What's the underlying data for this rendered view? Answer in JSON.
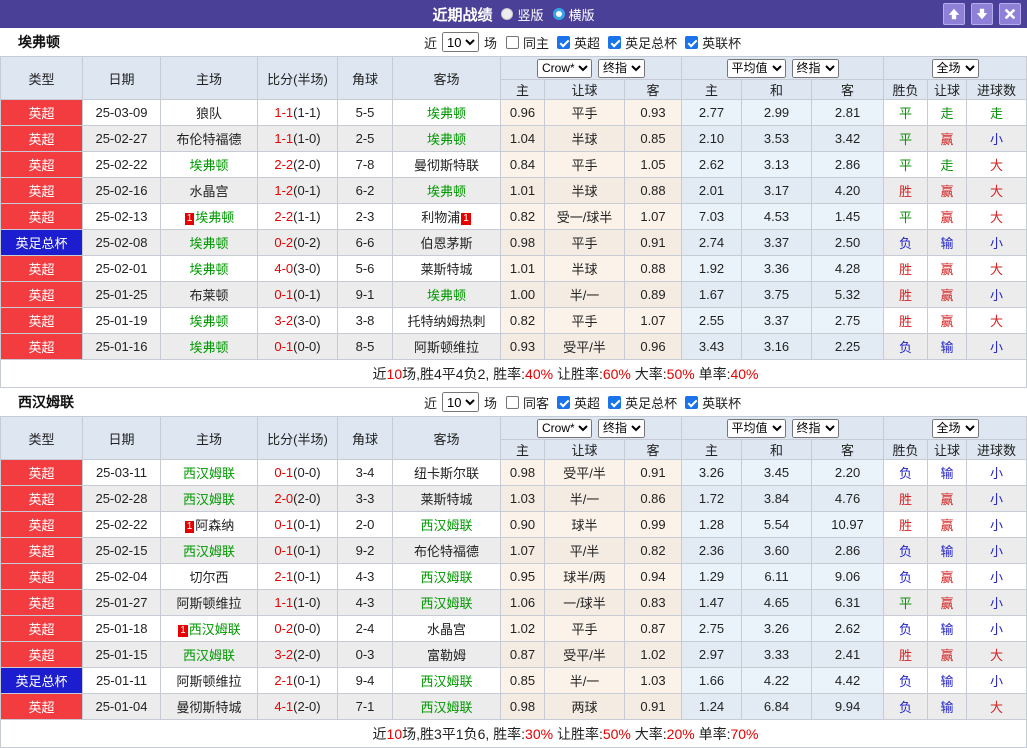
{
  "titlebar": {
    "title": "近期战绩",
    "radios": [
      {
        "label": "竖版",
        "selected": true
      },
      {
        "label": "横版",
        "selected": false
      }
    ],
    "buttons": {
      "up": "move-up",
      "down": "move-down",
      "close": "close"
    }
  },
  "colors": {
    "titlebar_bg": "#4b4098",
    "titlebar_button_bg": "#8d80d6",
    "header_bg": "#dde6f1",
    "league_colors": {
      "英超": "#f23c40",
      "英足总杯": "#1d1dd0"
    },
    "team_highlight": "#009900",
    "score_red": "#e60000",
    "handicap_col_bg": "#fbf3ea",
    "euro_col_bg": "#eaf3fa",
    "row_alt_bg": "#ececec",
    "summary_red": "#e60000",
    "result_map": {
      "胜": "#d42424",
      "赢": "#d42424",
      "大": "#d42424",
      "平": "#089008",
      "走": "#089008",
      "负": "#2424c8",
      "输": "#2424c8",
      "小": "#2424c8"
    }
  },
  "columns": {
    "type": "类型",
    "date": "日期",
    "home": "主场",
    "score": "比分(半场)",
    "corner": "角球",
    "away": "客场",
    "h": "主",
    "handicap": "让球",
    "a": "客",
    "eu_h": "主",
    "eu_d": "和",
    "eu_a": "客",
    "wdl": "胜负",
    "ah_res": "让球",
    "goals": "进球数"
  },
  "sections": [
    {
      "team": "埃弗顿",
      "controls": {
        "near": "近",
        "count": "10",
        "unit": "场",
        "same_label": "同主",
        "same_checked": false,
        "filters": [
          {
            "label": "英超",
            "checked": true
          },
          {
            "label": "英足总杯",
            "checked": true
          },
          {
            "label": "英联杯",
            "checked": true
          }
        ]
      },
      "dropdowns": {
        "odds_source": "Crow*",
        "odds_final": "终指",
        "euro_type": "平均值",
        "euro_final": "终指",
        "scope": "全场"
      },
      "rows": [
        {
          "league": "英超",
          "date": "25-03-09",
          "home": {
            "t": "狼队"
          },
          "score": "1-1",
          "half": "(1-1)",
          "corners": "5-5",
          "away": {
            "t": "埃弗顿",
            "g": true
          },
          "ah": [
            "0.96",
            "平手",
            "0.93"
          ],
          "eu": [
            "2.77",
            "2.99",
            "2.81"
          ],
          "res": [
            "平",
            "走",
            "走"
          ]
        },
        {
          "league": "英超",
          "date": "25-02-27",
          "home": {
            "t": "布伦特福德"
          },
          "score": "1-1",
          "half": "(1-0)",
          "corners": "2-5",
          "away": {
            "t": "埃弗顿",
            "g": true
          },
          "ah": [
            "1.04",
            "半球",
            "0.85"
          ],
          "eu": [
            "2.10",
            "3.53",
            "3.42"
          ],
          "res": [
            "平",
            "赢",
            "小"
          ]
        },
        {
          "league": "英超",
          "date": "25-02-22",
          "home": {
            "t": "埃弗顿",
            "g": true
          },
          "score": "2-2",
          "half": "(2-0)",
          "corners": "7-8",
          "away": {
            "t": "曼彻斯特联"
          },
          "ah": [
            "0.84",
            "平手",
            "1.05"
          ],
          "eu": [
            "2.62",
            "3.13",
            "2.86"
          ],
          "res": [
            "平",
            "走",
            "大"
          ]
        },
        {
          "league": "英超",
          "date": "25-02-16",
          "home": {
            "t": "水晶宫"
          },
          "score": "1-2",
          "half": "(0-1)",
          "corners": "6-2",
          "away": {
            "t": "埃弗顿",
            "g": true
          },
          "ah": [
            "1.01",
            "半球",
            "0.88"
          ],
          "eu": [
            "2.01",
            "3.17",
            "4.20"
          ],
          "res": [
            "胜",
            "赢",
            "大"
          ]
        },
        {
          "league": "英超",
          "date": "25-02-13",
          "home": {
            "t": "埃弗顿",
            "g": true,
            "b": "1",
            "bp": "pre"
          },
          "score": "2-2",
          "half": "(1-1)",
          "corners": "2-3",
          "away": {
            "t": "利物浦",
            "b": "1",
            "bp": "post"
          },
          "ah": [
            "0.82",
            "受一/球半",
            "1.07"
          ],
          "eu": [
            "7.03",
            "4.53",
            "1.45"
          ],
          "res": [
            "平",
            "赢",
            "大"
          ]
        },
        {
          "league": "英足总杯",
          "date": "25-02-08",
          "home": {
            "t": "埃弗顿",
            "g": true
          },
          "score": "0-2",
          "half": "(0-2)",
          "corners": "6-6",
          "away": {
            "t": "伯恩茅斯"
          },
          "ah": [
            "0.98",
            "平手",
            "0.91"
          ],
          "eu": [
            "2.74",
            "3.37",
            "2.50"
          ],
          "res": [
            "负",
            "输",
            "小"
          ]
        },
        {
          "league": "英超",
          "date": "25-02-01",
          "home": {
            "t": "埃弗顿",
            "g": true
          },
          "score": "4-0",
          "half": "(3-0)",
          "corners": "5-6",
          "away": {
            "t": "莱斯特城"
          },
          "ah": [
            "1.01",
            "半球",
            "0.88"
          ],
          "eu": [
            "1.92",
            "3.36",
            "4.28"
          ],
          "res": [
            "胜",
            "赢",
            "大"
          ]
        },
        {
          "league": "英超",
          "date": "25-01-25",
          "home": {
            "t": "布莱顿"
          },
          "score": "0-1",
          "half": "(0-1)",
          "corners": "9-1",
          "away": {
            "t": "埃弗顿",
            "g": true
          },
          "ah": [
            "1.00",
            "半/一",
            "0.89"
          ],
          "eu": [
            "1.67",
            "3.75",
            "5.32"
          ],
          "res": [
            "胜",
            "赢",
            "小"
          ]
        },
        {
          "league": "英超",
          "date": "25-01-19",
          "home": {
            "t": "埃弗顿",
            "g": true
          },
          "score": "3-2",
          "half": "(3-0)",
          "corners": "3-8",
          "away": {
            "t": "托特纳姆热刺"
          },
          "ah": [
            "0.82",
            "平手",
            "1.07"
          ],
          "eu": [
            "2.55",
            "3.37",
            "2.75"
          ],
          "res": [
            "胜",
            "赢",
            "大"
          ]
        },
        {
          "league": "英超",
          "date": "25-01-16",
          "home": {
            "t": "埃弗顿",
            "g": true
          },
          "score": "0-1",
          "half": "(0-0)",
          "corners": "8-5",
          "away": {
            "t": "阿斯顿维拉"
          },
          "ah": [
            "0.93",
            "受平/半",
            "0.96"
          ],
          "eu": [
            "3.43",
            "3.16",
            "2.25"
          ],
          "res": [
            "负",
            "输",
            "小"
          ]
        }
      ],
      "summary": [
        {
          "t": "近",
          "r": false
        },
        {
          "t": "10",
          "r": true
        },
        {
          "t": "场,胜4平4负2, 胜率:",
          "r": false
        },
        {
          "t": "40%",
          "r": true
        },
        {
          "t": " 让胜率:",
          "r": false
        },
        {
          "t": "60%",
          "r": true
        },
        {
          "t": " 大率:",
          "r": false
        },
        {
          "t": "50%",
          "r": true
        },
        {
          "t": " 单率:",
          "r": false
        },
        {
          "t": "40%",
          "r": true
        }
      ]
    },
    {
      "team": "西汉姆联",
      "controls": {
        "near": "近",
        "count": "10",
        "unit": "场",
        "same_label": "同客",
        "same_checked": false,
        "filters": [
          {
            "label": "英超",
            "checked": true
          },
          {
            "label": "英足总杯",
            "checked": true
          },
          {
            "label": "英联杯",
            "checked": true
          }
        ]
      },
      "dropdowns": {
        "odds_source": "Crow*",
        "odds_final": "终指",
        "euro_type": "平均值",
        "euro_final": "终指",
        "scope": "全场"
      },
      "rows": [
        {
          "league": "英超",
          "date": "25-03-11",
          "home": {
            "t": "西汉姆联",
            "g": true
          },
          "score": "0-1",
          "half": "(0-0)",
          "corners": "3-4",
          "away": {
            "t": "纽卡斯尔联"
          },
          "ah": [
            "0.98",
            "受平/半",
            "0.91"
          ],
          "eu": [
            "3.26",
            "3.45",
            "2.20"
          ],
          "res": [
            "负",
            "输",
            "小"
          ]
        },
        {
          "league": "英超",
          "date": "25-02-28",
          "home": {
            "t": "西汉姆联",
            "g": true
          },
          "score": "2-0",
          "half": "(2-0)",
          "corners": "3-3",
          "away": {
            "t": "莱斯特城"
          },
          "ah": [
            "1.03",
            "半/一",
            "0.86"
          ],
          "eu": [
            "1.72",
            "3.84",
            "4.76"
          ],
          "res": [
            "胜",
            "赢",
            "小"
          ]
        },
        {
          "league": "英超",
          "date": "25-02-22",
          "home": {
            "t": "阿森纳",
            "b": "1",
            "bp": "pre"
          },
          "score": "0-1",
          "half": "(0-1)",
          "corners": "2-0",
          "away": {
            "t": "西汉姆联",
            "g": true
          },
          "ah": [
            "0.90",
            "球半",
            "0.99"
          ],
          "eu": [
            "1.28",
            "5.54",
            "10.97"
          ],
          "res": [
            "胜",
            "赢",
            "小"
          ]
        },
        {
          "league": "英超",
          "date": "25-02-15",
          "home": {
            "t": "西汉姆联",
            "g": true
          },
          "score": "0-1",
          "half": "(0-1)",
          "corners": "9-2",
          "away": {
            "t": "布伦特福德"
          },
          "ah": [
            "1.07",
            "平/半",
            "0.82"
          ],
          "eu": [
            "2.36",
            "3.60",
            "2.86"
          ],
          "res": [
            "负",
            "输",
            "小"
          ]
        },
        {
          "league": "英超",
          "date": "25-02-04",
          "home": {
            "t": "切尔西"
          },
          "score": "2-1",
          "half": "(0-1)",
          "corners": "4-3",
          "away": {
            "t": "西汉姆联",
            "g": true
          },
          "ah": [
            "0.95",
            "球半/两",
            "0.94"
          ],
          "eu": [
            "1.29",
            "6.11",
            "9.06"
          ],
          "res": [
            "负",
            "赢",
            "小"
          ]
        },
        {
          "league": "英超",
          "date": "25-01-27",
          "home": {
            "t": "阿斯顿维拉"
          },
          "score": "1-1",
          "half": "(1-0)",
          "corners": "4-3",
          "away": {
            "t": "西汉姆联",
            "g": true
          },
          "ah": [
            "1.06",
            "一/球半",
            "0.83"
          ],
          "eu": [
            "1.47",
            "4.65",
            "6.31"
          ],
          "res": [
            "平",
            "赢",
            "小"
          ]
        },
        {
          "league": "英超",
          "date": "25-01-18",
          "home": {
            "t": "西汉姆联",
            "g": true,
            "b": "1",
            "bp": "pre"
          },
          "score": "0-2",
          "half": "(0-0)",
          "corners": "2-4",
          "away": {
            "t": "水晶宫"
          },
          "ah": [
            "1.02",
            "平手",
            "0.87"
          ],
          "eu": [
            "2.75",
            "3.26",
            "2.62"
          ],
          "res": [
            "负",
            "输",
            "小"
          ]
        },
        {
          "league": "英超",
          "date": "25-01-15",
          "home": {
            "t": "西汉姆联",
            "g": true
          },
          "score": "3-2",
          "half": "(2-0)",
          "corners": "0-3",
          "away": {
            "t": "富勒姆"
          },
          "ah": [
            "0.87",
            "受平/半",
            "1.02"
          ],
          "eu": [
            "2.97",
            "3.33",
            "2.41"
          ],
          "res": [
            "胜",
            "赢",
            "大"
          ]
        },
        {
          "league": "英足总杯",
          "date": "25-01-11",
          "home": {
            "t": "阿斯顿维拉"
          },
          "score": "2-1",
          "half": "(0-1)",
          "corners": "9-4",
          "away": {
            "t": "西汉姆联",
            "g": true
          },
          "ah": [
            "0.85",
            "半/一",
            "1.03"
          ],
          "eu": [
            "1.66",
            "4.22",
            "4.42"
          ],
          "res": [
            "负",
            "输",
            "小"
          ]
        },
        {
          "league": "英超",
          "date": "25-01-04",
          "home": {
            "t": "曼彻斯特城"
          },
          "score": "4-1",
          "half": "(2-0)",
          "corners": "7-1",
          "away": {
            "t": "西汉姆联",
            "g": true
          },
          "ah": [
            "0.98",
            "两球",
            "0.91"
          ],
          "eu": [
            "1.24",
            "6.84",
            "9.94"
          ],
          "res": [
            "负",
            "输",
            "大"
          ]
        }
      ],
      "summary": [
        {
          "t": "近",
          "r": false
        },
        {
          "t": "10",
          "r": true
        },
        {
          "t": "场,胜3平1负6, 胜率:",
          "r": false
        },
        {
          "t": "30%",
          "r": true
        },
        {
          "t": " 让胜率:",
          "r": false
        },
        {
          "t": "50%",
          "r": true
        },
        {
          "t": " 大率:",
          "r": false
        },
        {
          "t": "20%",
          "r": true
        },
        {
          "t": " 单率:",
          "r": false
        },
        {
          "t": "70%",
          "r": true
        }
      ]
    }
  ]
}
